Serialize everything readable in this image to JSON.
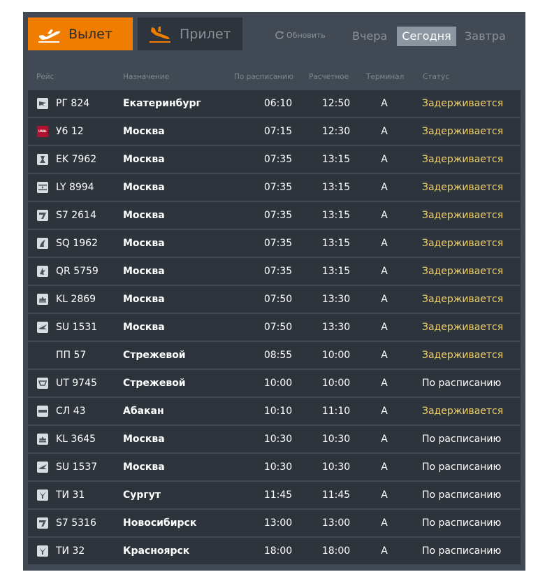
{
  "tabs": {
    "departures": "Вылет",
    "arrivals": "Прилет"
  },
  "refresh_label": "Обновить",
  "days": {
    "yesterday": "Вчера",
    "today": "Сегодня",
    "tomorrow": "Завтра"
  },
  "columns": {
    "flight": "Рейс",
    "destination": "Назначение",
    "scheduled": "По расписанию",
    "estimated": "Расчетное",
    "terminal": "Терминал",
    "status": "Статус"
  },
  "colors": {
    "accent": "#f07d00",
    "delayed": "#f0d26a"
  },
  "flights": [
    {
      "logo": "ru-airline-icon",
      "flight": "РГ 824",
      "destination": "Екатеринбург",
      "scheduled": "06:10",
      "estimated": "12:50",
      "terminal": "A",
      "status": "Задерживается",
      "delayed": true
    },
    {
      "logo": "ural-airlines-icon",
      "logo_text": "URAL",
      "flight": "У6 12",
      "destination": "Москва",
      "scheduled": "07:15",
      "estimated": "12:30",
      "terminal": "A",
      "status": "Задерживается",
      "delayed": true
    },
    {
      "logo": "emirates-icon",
      "flight": "EK 7962",
      "destination": "Москва",
      "scheduled": "07:35",
      "estimated": "13:15",
      "terminal": "A",
      "status": "Задерживается",
      "delayed": true
    },
    {
      "logo": "el-al-icon",
      "flight": "LY 8994",
      "destination": "Москва",
      "scheduled": "07:35",
      "estimated": "13:15",
      "terminal": "A",
      "status": "Задерживается",
      "delayed": true
    },
    {
      "logo": "s7-icon",
      "flight": "S7 2614",
      "destination": "Москва",
      "scheduled": "07:35",
      "estimated": "13:15",
      "terminal": "A",
      "status": "Задерживается",
      "delayed": true
    },
    {
      "logo": "singapore-airlines-icon",
      "flight": "SQ 1962",
      "destination": "Москва",
      "scheduled": "07:35",
      "estimated": "13:15",
      "terminal": "A",
      "status": "Задерживается",
      "delayed": true
    },
    {
      "logo": "qatar-airways-icon",
      "flight": "QR 5759",
      "destination": "Москва",
      "scheduled": "07:35",
      "estimated": "13:15",
      "terminal": "A",
      "status": "Задерживается",
      "delayed": true
    },
    {
      "logo": "klm-icon",
      "flight": "KL 2869",
      "destination": "Москва",
      "scheduled": "07:50",
      "estimated": "13:30",
      "terminal": "A",
      "status": "Задерживается",
      "delayed": true
    },
    {
      "logo": "aeroflot-icon",
      "flight": "SU 1531",
      "destination": "Москва",
      "scheduled": "07:50",
      "estimated": "13:30",
      "terminal": "A",
      "status": "Задерживается",
      "delayed": true
    },
    {
      "logo": "",
      "flight": "ПП 57",
      "destination": "Стрежевой",
      "scheduled": "08:55",
      "estimated": "10:00",
      "terminal": "A",
      "status": "Задерживается",
      "delayed": true
    },
    {
      "logo": "utair-icon",
      "flight": "UT 9745",
      "destination": "Стрежевой",
      "scheduled": "10:00",
      "estimated": "10:00",
      "terminal": "A",
      "status": "По расписанию",
      "delayed": false
    },
    {
      "logo": "siberia-airline-icon",
      "flight": "СЛ 43",
      "destination": "Абакан",
      "scheduled": "10:10",
      "estimated": "11:10",
      "terminal": "A",
      "status": "Задерживается",
      "delayed": true
    },
    {
      "logo": "klm-icon",
      "flight": "KL 3645",
      "destination": "Москва",
      "scheduled": "10:30",
      "estimated": "10:30",
      "terminal": "A",
      "status": "По расписанию",
      "delayed": false
    },
    {
      "logo": "aeroflot-icon",
      "flight": "SU 1537",
      "destination": "Москва",
      "scheduled": "10:30",
      "estimated": "10:30",
      "terminal": "A",
      "status": "По расписанию",
      "delayed": false
    },
    {
      "logo": "ti-airline-icon",
      "flight": "ТИ 31",
      "destination": "Сургут",
      "scheduled": "11:45",
      "estimated": "11:45",
      "terminal": "A",
      "status": "По расписанию",
      "delayed": false
    },
    {
      "logo": "s7-icon",
      "flight": "S7 5316",
      "destination": "Новосибирск",
      "scheduled": "13:00",
      "estimated": "13:00",
      "terminal": "A",
      "status": "По расписанию",
      "delayed": false
    },
    {
      "logo": "ti-airline-icon",
      "flight": "ТИ 32",
      "destination": "Красноярск",
      "scheduled": "18:00",
      "estimated": "18:00",
      "terminal": "A",
      "status": "По расписанию",
      "delayed": false
    }
  ]
}
